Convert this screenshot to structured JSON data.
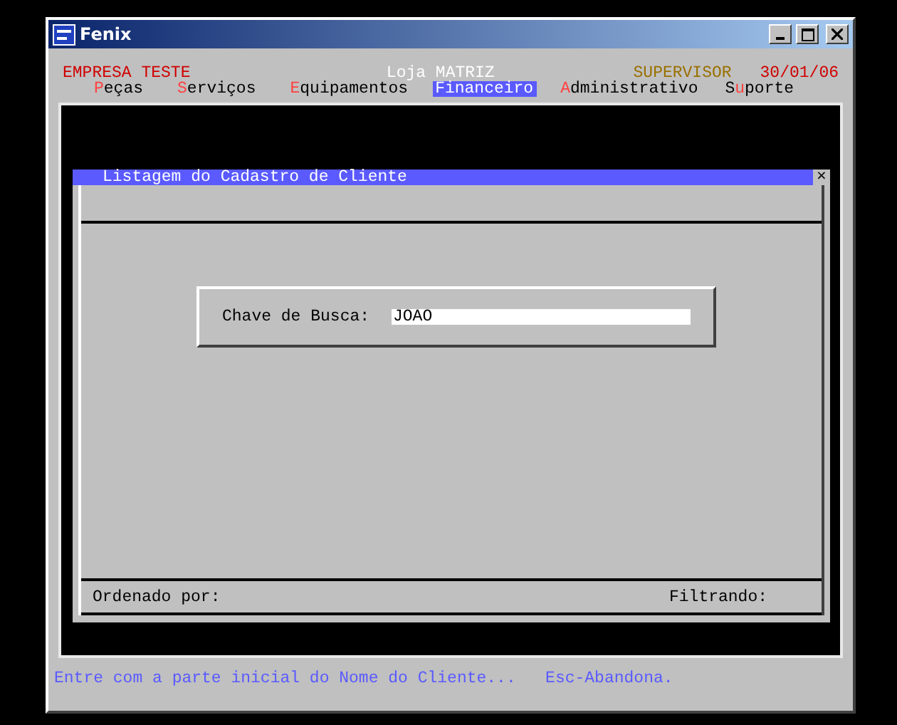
{
  "window": {
    "title": "Fenix"
  },
  "header": {
    "company": "EMPRESA TESTE",
    "store": "Loja MATRIZ",
    "user": "SUPERVISOR",
    "date": "30/01/06"
  },
  "menu": [
    {
      "hotkey": "P",
      "after": "eças",
      "selected": false
    },
    {
      "hotkey": "S",
      "after": "erviços",
      "selected": false
    },
    {
      "hotkey": "E",
      "after": "quipamentos",
      "selected": false
    },
    {
      "hotkey": "F",
      "after": "inanceiro",
      "selected": true
    },
    {
      "hotkey": "A",
      "after": "dministrativo",
      "selected": false
    },
    {
      "before": "S",
      "hotkey": "u",
      "after": "porte",
      "selected": false
    }
  ],
  "dialog": {
    "title": "Listagem do Cadastro de Cliente",
    "close": "×",
    "search": {
      "label": "Chave de Busca:",
      "value": "JOAO"
    },
    "sorted_by": "Ordenado por:",
    "filtering": "Filtrando:"
  },
  "status_bar": "Entre com a parte inicial do Nome do Cliente...   Esc-Abandona."
}
